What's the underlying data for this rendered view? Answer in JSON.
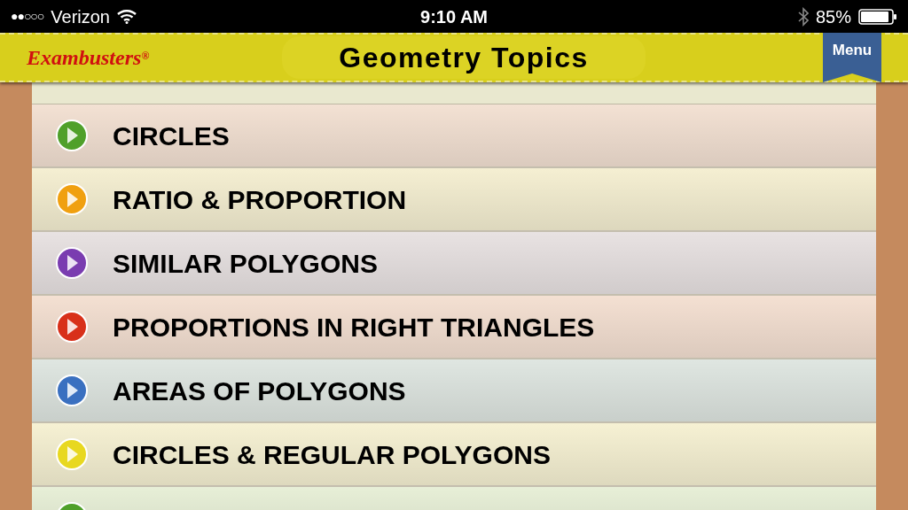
{
  "status_bar": {
    "signal_dots": "●●○○○",
    "carrier": "Verizon",
    "time": "9:10 AM",
    "battery": "85%"
  },
  "header": {
    "logo": "Exambusters",
    "logo_mark": "®",
    "title": "Geometry Topics",
    "menu_button": "Menu"
  },
  "topics": [
    {
      "label": "CIRCLES",
      "color": "#4fa02a"
    },
    {
      "label": "RATIO & PROPORTION",
      "color": "#f0a010"
    },
    {
      "label": "SIMILAR POLYGONS",
      "color": "#7a3cb0"
    },
    {
      "label": "PROPORTIONS IN RIGHT TRIANGLES",
      "color": "#d8301a"
    },
    {
      "label": "AREAS OF POLYGONS",
      "color": "#3a70c0"
    },
    {
      "label": "CIRCLES & REGULAR POLYGONS",
      "color": "#e8d820"
    },
    {
      "color": "#4fa02a"
    }
  ]
}
